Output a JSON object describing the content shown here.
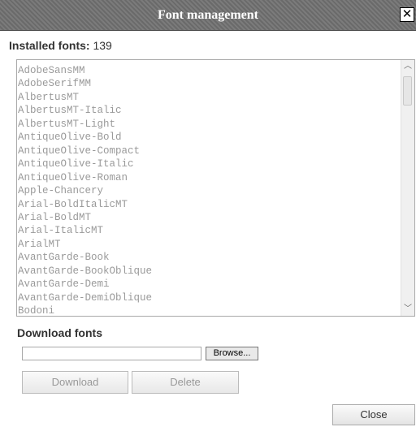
{
  "dialog": {
    "title": "Font management",
    "close_glyph": "✕"
  },
  "installed": {
    "label": "Installed fonts:",
    "count": "139"
  },
  "fonts": [
    "AdobeSansMM",
    "AdobeSerifMM",
    "AlbertusMT",
    "AlbertusMT-Italic",
    "AlbertusMT-Light",
    "AntiqueOlive-Bold",
    "AntiqueOlive-Compact",
    "AntiqueOlive-Italic",
    "AntiqueOlive-Roman",
    "Apple-Chancery",
    "Arial-BoldItalicMT",
    "Arial-BoldMT",
    "Arial-ItalicMT",
    "ArialMT",
    "AvantGarde-Book",
    "AvantGarde-BookOblique",
    "AvantGarde-Demi",
    "AvantGarde-DemiOblique",
    "Bodoni"
  ],
  "scrollbar": {
    "up_icon": "chevron-up-icon",
    "down_icon": "chevron-down-icon",
    "up_glyph": "︿",
    "down_glyph": "﹀"
  },
  "download": {
    "title": "Download fonts",
    "browse_label": "Browse...",
    "file_value": "",
    "download_label": "Download",
    "delete_label": "Delete"
  },
  "footer": {
    "close_label": "Close"
  }
}
